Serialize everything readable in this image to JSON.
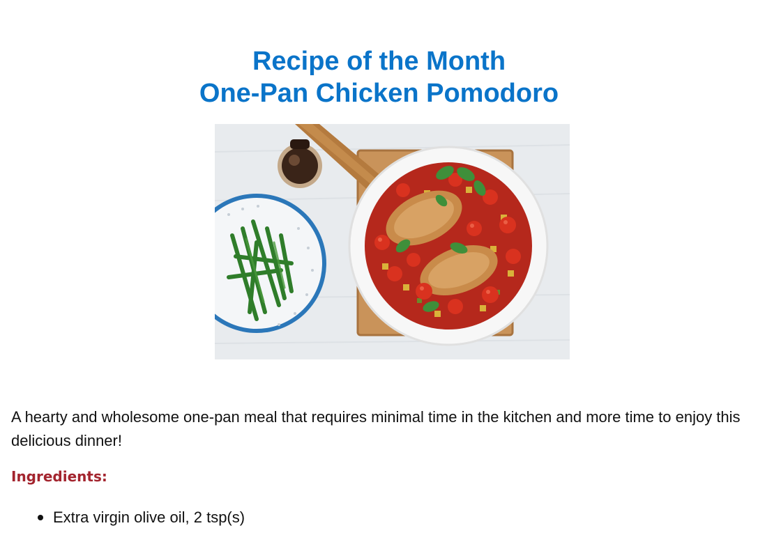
{
  "header": {
    "title_line1": "Recipe of the Month",
    "title_line2": "One-Pan Chicken Pomodoro"
  },
  "photo": {
    "subject": "one-pan chicken pomodoro in a white skillet with tomatoes, zucchini and basil, beside a colander of green beans and a small bottle on a wooden board",
    "colors": {
      "table": "#e8ebee",
      "board": "#c9935a",
      "pan": "#f7f7f7",
      "sauce": "#b5281c",
      "tomato": "#d9321f",
      "chicken": "#c98b4a",
      "basil": "#3f8f3a",
      "beans": "#2f7d2a",
      "colander_rim": "#2b77b9"
    }
  },
  "intro": {
    "text": "A hearty and wholesome one-pan meal that requires minimal time in the kitchen and more time to enjoy this delicious dinner!"
  },
  "ingredients": {
    "heading": "Ingredients:",
    "items": [
      "Extra virgin olive oil, 2 tsp(s)"
    ]
  },
  "colors": {
    "title": "#0a74c9",
    "heading": "#a3242e",
    "body_text": "#111111"
  }
}
